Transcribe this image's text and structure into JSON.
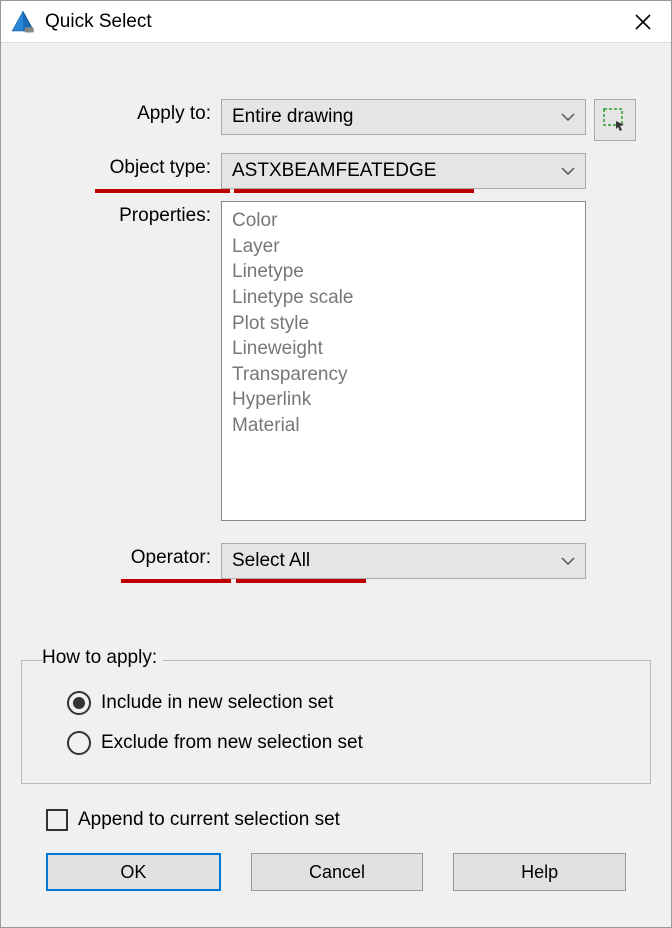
{
  "title": "Quick Select",
  "labels": {
    "apply_to": "Apply to:",
    "object_type": "Object type:",
    "properties": "Properties:",
    "operator": "Operator:"
  },
  "fields": {
    "apply_to": "Entire drawing",
    "object_type": "ASTXBEAMFEATEDGE",
    "operator": "Select All"
  },
  "properties_list": [
    "Color",
    "Layer",
    "Linetype",
    "Linetype scale",
    "Plot style",
    "Lineweight",
    "Transparency",
    "Hyperlink",
    "Material"
  ],
  "groupbox": {
    "title": "How to apply:",
    "radio_include": "Include in new selection set",
    "radio_exclude": "Exclude from new selection set",
    "selected": "include"
  },
  "checkbox": {
    "append": "Append to current selection set",
    "checked": false
  },
  "buttons": {
    "ok": "OK",
    "cancel": "Cancel",
    "help": "Help"
  }
}
